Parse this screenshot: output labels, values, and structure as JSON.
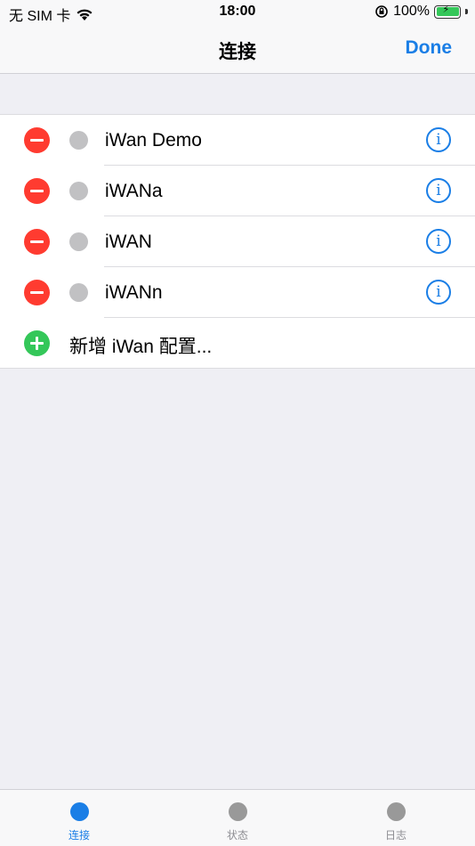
{
  "status_bar": {
    "carrier": "无 SIM 卡",
    "time": "18:00",
    "battery": "100%"
  },
  "nav": {
    "title": "连接",
    "done_label": "Done"
  },
  "connections": [
    {
      "name": "iWan Demo"
    },
    {
      "name": "iWANa"
    },
    {
      "name": "iWAN"
    },
    {
      "name": "iWANn"
    }
  ],
  "add_label": "新增 iWan 配置...",
  "info_glyph": "i",
  "tabs": [
    {
      "label": "连接",
      "active": true
    },
    {
      "label": "状态",
      "active": false
    },
    {
      "label": "日志",
      "active": false
    }
  ],
  "colors": {
    "accent": "#1a7ee6",
    "delete": "#ff3b30",
    "add": "#34c759",
    "status_dot": "#c1c1c3"
  }
}
